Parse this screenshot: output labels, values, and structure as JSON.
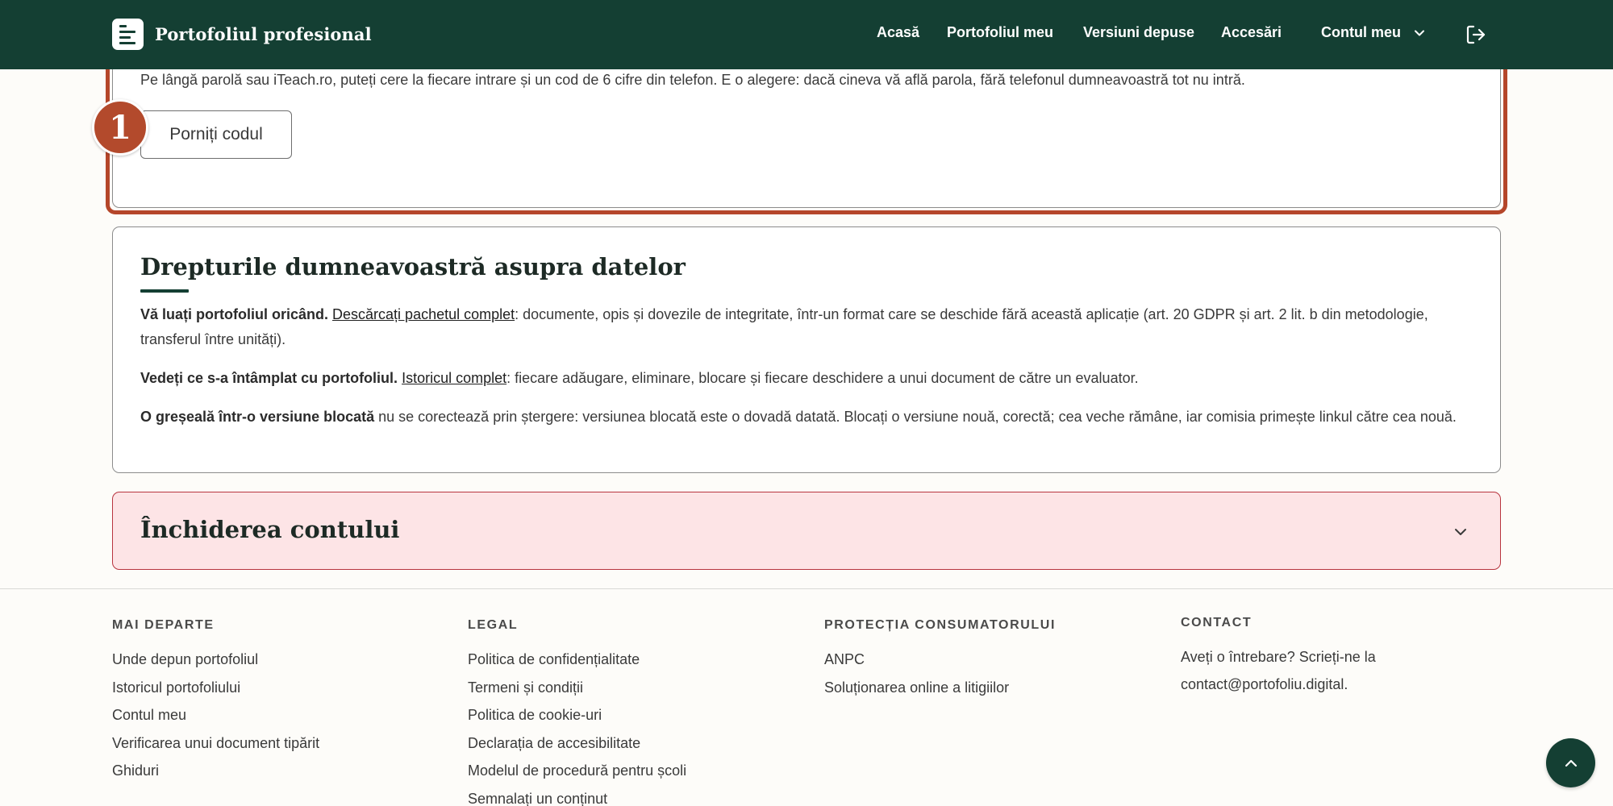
{
  "app": {
    "brand_name": "Portofoliul profesional"
  },
  "nav": {
    "items": [
      "Acasă",
      "Portofoliul meu",
      "Versiuni depuse",
      "Accesări"
    ],
    "account_label": "Contul meu"
  },
  "twofa": {
    "description": "Pe lângă parolă sau iTeach.ro, puteți cere la fiecare intrare și un cod de 6 cifre din telefon. E o alegere: dacă cineva vă află parola, fără telefonul dumneavoastră tot nu intră.",
    "button_label": "Porniți codul",
    "step_number": "1"
  },
  "rights": {
    "title": "Drepturile dumneavoastră asupra datelor",
    "p1_bold": "Vă luați portofoliul oricând.",
    "p1_link": "Descărcați pachetul complet",
    "p1_rest": ": documente, opis și dovezile de integritate, într-un format care se deschide fără această aplicație (art. 20 GDPR și art. 2 lit. b din metodologie, transferul între unități).",
    "p2_bold": "Vedeți ce s-a întâmplat cu portofoliul.",
    "p2_link": "Istoricul complet",
    "p2_rest": ": fiecare adăugare, eliminare, blocare și fiecare deschidere a unui document de către un evaluator.",
    "p3_bold": "O greșeală într-o versiune blocată",
    "p3_rest": " nu se corectează prin ștergere: versiunea blocată este o dovadă datată. Blocați o versiune nouă, corectă; cea veche rămâne, iar comisia primește linkul către cea nouă."
  },
  "close_account": {
    "title": "Închiderea contului"
  },
  "footer": {
    "col1": {
      "heading": "MAI DEPARTE",
      "links": [
        "Unde depun portofoliul",
        "Istoricul portofoliului",
        "Contul meu",
        "Verificarea unui document tipărit",
        "Ghiduri"
      ]
    },
    "col2": {
      "heading": "LEGAL",
      "links": [
        "Politica de confidențialitate",
        "Termeni și condiții",
        "Politica de cookie-uri",
        "Declarația de accesibilitate",
        "Modelul de procedură pentru școli",
        "Semnalați un conținut"
      ]
    },
    "col3": {
      "heading": "PROTECȚIA CONSUMATORULUI",
      "links": [
        "ANPC",
        "Soluționarea online a litigiilor"
      ]
    },
    "col4": {
      "heading": "CONTACT",
      "text": "Aveți o întrebare? Scrieți-ne la contact@portofoliu.digital."
    }
  },
  "colors": {
    "header_bg": "#143f33",
    "highlight": "#b5462a",
    "danger_bg": "#fde4e6",
    "danger_border": "#b8343f"
  },
  "icons": [
    "document-logo-icon",
    "chevron-down-icon",
    "logout-icon",
    "arrow-up-icon"
  ]
}
